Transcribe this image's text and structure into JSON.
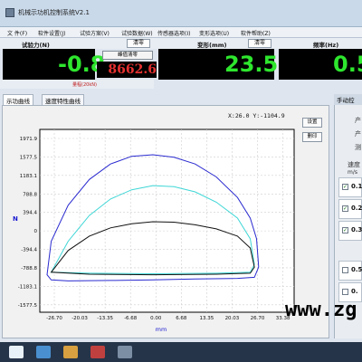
{
  "window": {
    "title": "机械示功机控制系统V2.1"
  },
  "menu": {
    "items": [
      "文 件(F)",
      "软件设置(J)",
      "试验方案(V)",
      "试验数据(W)",
      "传感器选项(I)",
      "变形选项(U)",
      "软件帮助(Z)"
    ]
  },
  "panels": {
    "force": {
      "label": "试验力(N)",
      "clear": "清零",
      "value": "-0.8",
      "peak_clear": "峰值清零",
      "peak_value": "8662.6",
      "range": "量程(20kN)"
    },
    "deform": {
      "label": "变形(mm)",
      "clear": "清零",
      "value": "23.5"
    },
    "freq": {
      "label": "频率(Hz)",
      "value": "0.5"
    }
  },
  "tabs": [
    "示功曲线",
    "速度特性曲线"
  ],
  "chart": {
    "readout": "X:26.0 Y:-1104.9",
    "settings_button": "设置",
    "print_button": "删印",
    "ylabel": "N",
    "xlabel": "mm",
    "yticks": [
      "1971.9",
      "1577.5",
      "1183.1",
      "788.8",
      "394.4",
      "0",
      "-394.4",
      "-788.8",
      "-1183.1",
      "-1577.5"
    ],
    "xticks": [
      "-26.70",
      "-20.03",
      "-13.35",
      "-6.68",
      "0.00",
      "6.68",
      "13.35",
      "20.03",
      "26.70",
      "33.38"
    ]
  },
  "chart_data": {
    "type": "line",
    "xlabel": "mm",
    "ylabel": "N",
    "xlim": [
      -26.7,
      33.38
    ],
    "ylim": [
      -1577.5,
      1971.9
    ],
    "series": [
      {
        "color": "#2a2ad0",
        "x": [
          -25,
          -24,
          -20,
          -15,
          -10,
          -5,
          0,
          5,
          10,
          15,
          20,
          23,
          24.5,
          25,
          24,
          20,
          10,
          0,
          -10,
          -20,
          -24,
          -25
        ],
        "y": [
          -850,
          -200,
          500,
          1000,
          1300,
          1450,
          1480,
          1430,
          1300,
          1050,
          650,
          250,
          -150,
          -700,
          -900,
          -920,
          -930,
          -950,
          -960,
          -970,
          -950,
          -850
        ]
      },
      {
        "color": "#3fd6d6",
        "x": [
          -24,
          -20,
          -15,
          -10,
          -5,
          0,
          5,
          10,
          15,
          20,
          23,
          24,
          23,
          15,
          0,
          -15,
          -24
        ],
        "y": [
          -800,
          -200,
          300,
          620,
          800,
          880,
          860,
          760,
          560,
          250,
          -150,
          -650,
          -800,
          -820,
          -830,
          -820,
          -800
        ]
      },
      {
        "color": "#111111",
        "x": [
          -24,
          -20,
          -15,
          -10,
          -5,
          0,
          5,
          10,
          15,
          20,
          23,
          24,
          23,
          15,
          0,
          -15,
          -24
        ],
        "y": [
          -800,
          -380,
          -100,
          60,
          140,
          180,
          170,
          120,
          40,
          -100,
          -330,
          -700,
          -820,
          -840,
          -850,
          -840,
          -800
        ]
      }
    ]
  },
  "right_panel": {
    "header": "手动控",
    "texts": [
      "产",
      "产",
      "测"
    ],
    "speed_label": "速度",
    "unit": "m/s",
    "items": [
      {
        "value": "0.1",
        "checked": "true"
      },
      {
        "value": "0.2",
        "checked": "true"
      },
      {
        "value": "0.3",
        "checked": "true"
      },
      {
        "value": "0.5",
        "checked": "false"
      },
      {
        "value": "0.",
        "checked": "false"
      }
    ]
  },
  "watermark": "www.zg"
}
